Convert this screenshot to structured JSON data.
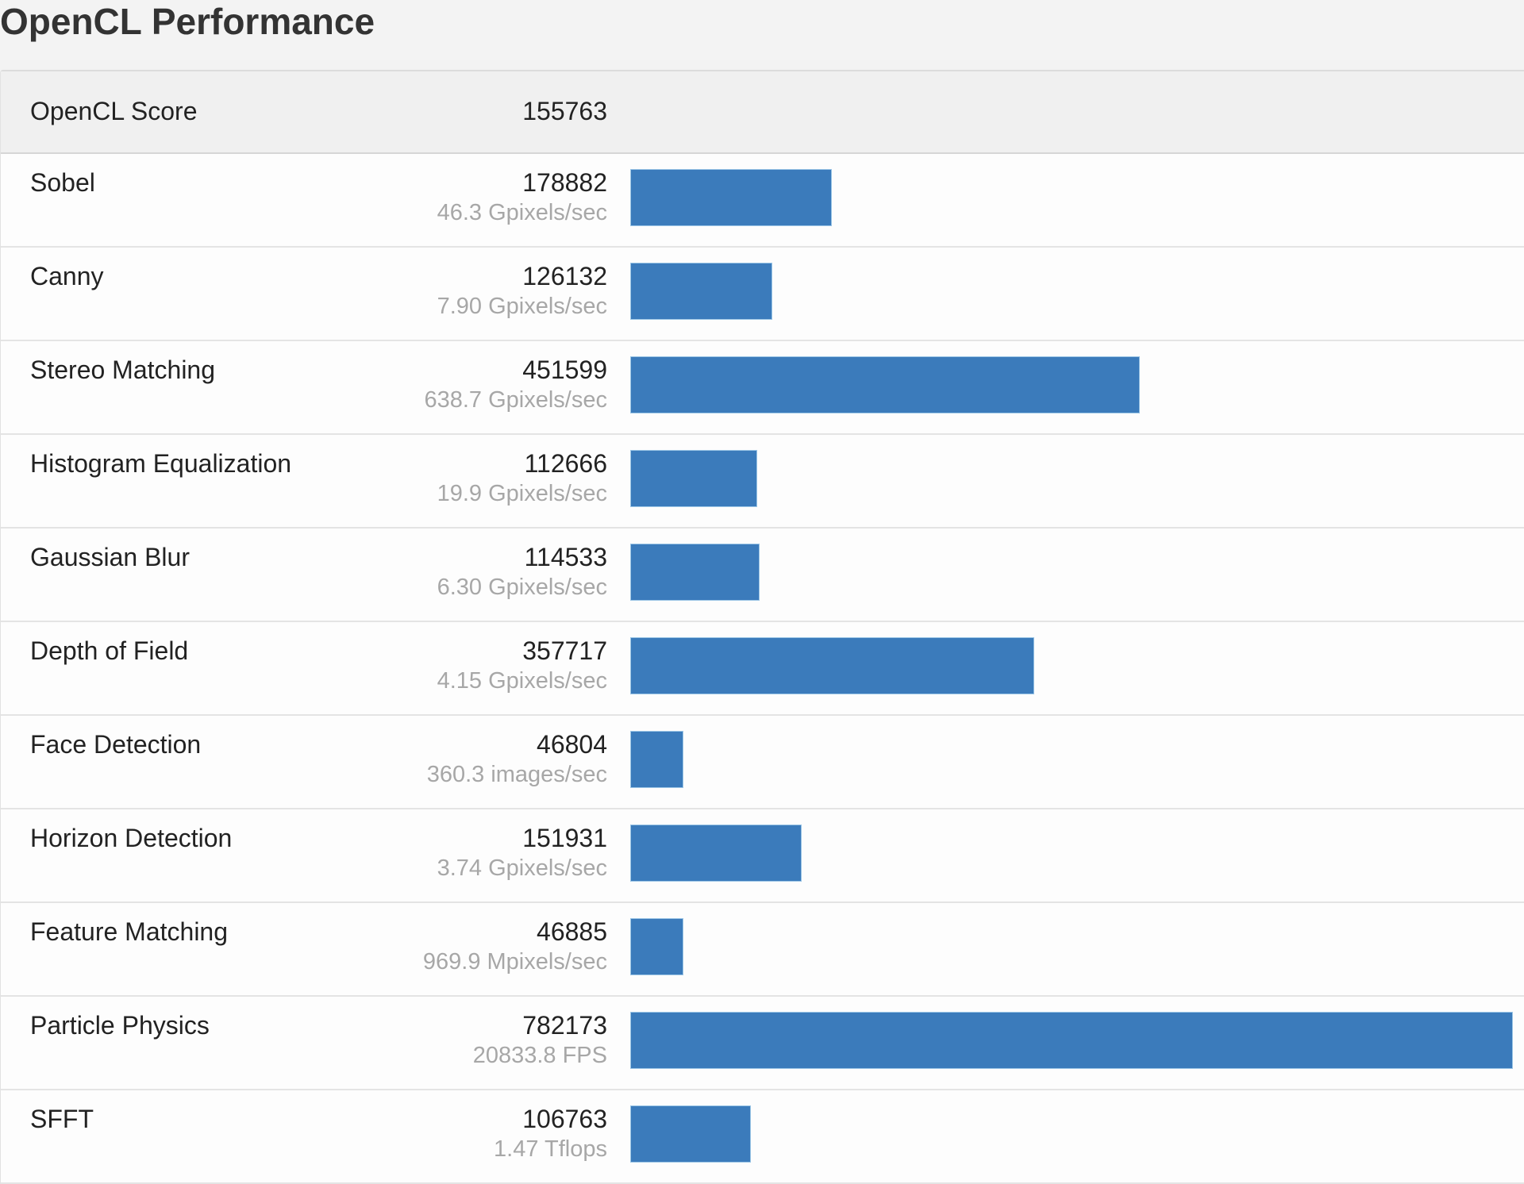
{
  "page": {
    "title": "OpenCL Performance"
  },
  "summary": {
    "label": "OpenCL Score",
    "score": "155763"
  },
  "accent_color": "#3b7bbb",
  "rows": [
    {
      "name": "Sobel",
      "score": "178882",
      "detail": "46.3 Gpixels/sec"
    },
    {
      "name": "Canny",
      "score": "126132",
      "detail": "7.90 Gpixels/sec"
    },
    {
      "name": "Stereo Matching",
      "score": "451599",
      "detail": "638.7 Gpixels/sec"
    },
    {
      "name": "Histogram Equalization",
      "score": "112666",
      "detail": "19.9 Gpixels/sec"
    },
    {
      "name": "Gaussian Blur",
      "score": "114533",
      "detail": "6.30 Gpixels/sec"
    },
    {
      "name": "Depth of Field",
      "score": "357717",
      "detail": "4.15 Gpixels/sec"
    },
    {
      "name": "Face Detection",
      "score": "46804",
      "detail": "360.3 images/sec"
    },
    {
      "name": "Horizon Detection",
      "score": "151931",
      "detail": "3.74 Gpixels/sec"
    },
    {
      "name": "Feature Matching",
      "score": "46885",
      "detail": "969.9 Mpixels/sec"
    },
    {
      "name": "Particle Physics",
      "score": "782173",
      "detail": "20833.8 FPS"
    },
    {
      "name": "SFFT",
      "score": "106763",
      "detail": "1.47 Tflops"
    }
  ],
  "chart_data": {
    "type": "bar",
    "orientation": "horizontal",
    "title": "OpenCL Performance",
    "categories": [
      "Sobel",
      "Canny",
      "Stereo Matching",
      "Histogram Equalization",
      "Gaussian Blur",
      "Depth of Field",
      "Face Detection",
      "Horizon Detection",
      "Feature Matching",
      "Particle Physics",
      "SFFT"
    ],
    "values": [
      178882,
      126132,
      451599,
      112666,
      114533,
      357717,
      46804,
      151931,
      46885,
      782173,
      106763
    ],
    "xlim": [
      0,
      782173
    ],
    "grid": false,
    "legend": "none"
  }
}
